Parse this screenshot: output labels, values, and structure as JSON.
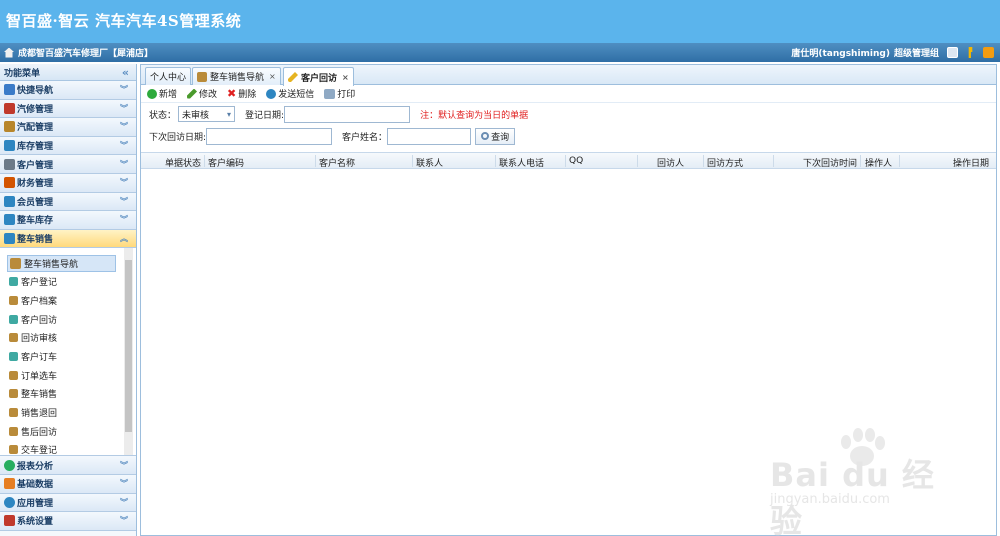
{
  "app": {
    "title": "智百盛·智云 汽车汽车4S管理系统"
  },
  "infobar": {
    "org": "成都智百盛汽车修理厂【犀浦店】",
    "user": "唐仕明(tangshiming)",
    "role": "超级管理组"
  },
  "sidebar": {
    "header": "功能菜单",
    "collapse_glyph": "«",
    "items": [
      {
        "label": "快捷导航",
        "icon": "home-icon",
        "color": "#3a7bc8"
      },
      {
        "label": "汽修管理",
        "icon": "wrench-icon",
        "color": "#c0392b"
      },
      {
        "label": "汽配管理",
        "icon": "parts-icon",
        "color": "#b8862b"
      },
      {
        "label": "库存管理",
        "icon": "warehouse-icon",
        "color": "#2e86c1"
      },
      {
        "label": "客户管理",
        "icon": "customer-icon",
        "color": "#6c7a89"
      },
      {
        "label": "财务管理",
        "icon": "finance-icon",
        "color": "#d35400"
      },
      {
        "label": "会员管理",
        "icon": "member-icon",
        "color": "#2e86c1"
      },
      {
        "label": "整车库存",
        "icon": "vehicle-stock-icon",
        "color": "#2e86c1"
      },
      {
        "label": "整车销售",
        "icon": "vehicle-sales-icon",
        "color": "#2e86c1"
      }
    ],
    "submenu": [
      {
        "label": "整车销售导航",
        "icon": "box-icon"
      },
      {
        "label": "客户登记",
        "icon": "doc-icon"
      },
      {
        "label": "客户档案",
        "icon": "box-icon"
      },
      {
        "label": "客户回访",
        "icon": "doc-icon"
      },
      {
        "label": "回访审核",
        "icon": "box-icon"
      },
      {
        "label": "客户订车",
        "icon": "doc-icon"
      },
      {
        "label": "订单选车",
        "icon": "box-icon"
      },
      {
        "label": "整车销售",
        "icon": "box-icon"
      },
      {
        "label": "销售退回",
        "icon": "box-icon"
      },
      {
        "label": "售后回访",
        "icon": "box-icon"
      },
      {
        "label": "交车登记",
        "icon": "box-icon"
      }
    ],
    "bottom_items": [
      {
        "label": "报表分析",
        "icon": "chart-icon",
        "color": "#27ae60"
      },
      {
        "label": "基础数据",
        "icon": "database-icon",
        "color": "#e67e22"
      },
      {
        "label": "应用管理",
        "icon": "app-icon",
        "color": "#2e86c1"
      },
      {
        "label": "系统设置",
        "icon": "settings-icon",
        "color": "#c0392b"
      }
    ]
  },
  "tabs": [
    {
      "label": "个人中心"
    },
    {
      "label": "整车销售导航",
      "close": "×"
    },
    {
      "label": "客户回访",
      "close": "×"
    }
  ],
  "toolbar": {
    "add": "新增",
    "edit": "修改",
    "delete": "删除",
    "sms": "发送短信",
    "print": "打印"
  },
  "filters": {
    "status_label": "状态：",
    "status_value": "未审核",
    "reg_date_label": "登记日期:",
    "note": "注：默认查询为当日的单据",
    "next_visit_label": "下次回访日期:",
    "customer_name_label": "客户姓名：",
    "query_button": "查询"
  },
  "grid": {
    "columns": [
      "单据状态",
      "客户编码",
      "客户名称",
      "联系人",
      "联系人电话",
      "QQ",
      "回访人",
      "回访方式",
      "下次回访时间",
      "操作人",
      "操作日期"
    ]
  },
  "watermark": {
    "brand": "Bai du 经验",
    "url": "jingyan.baidu.com"
  }
}
